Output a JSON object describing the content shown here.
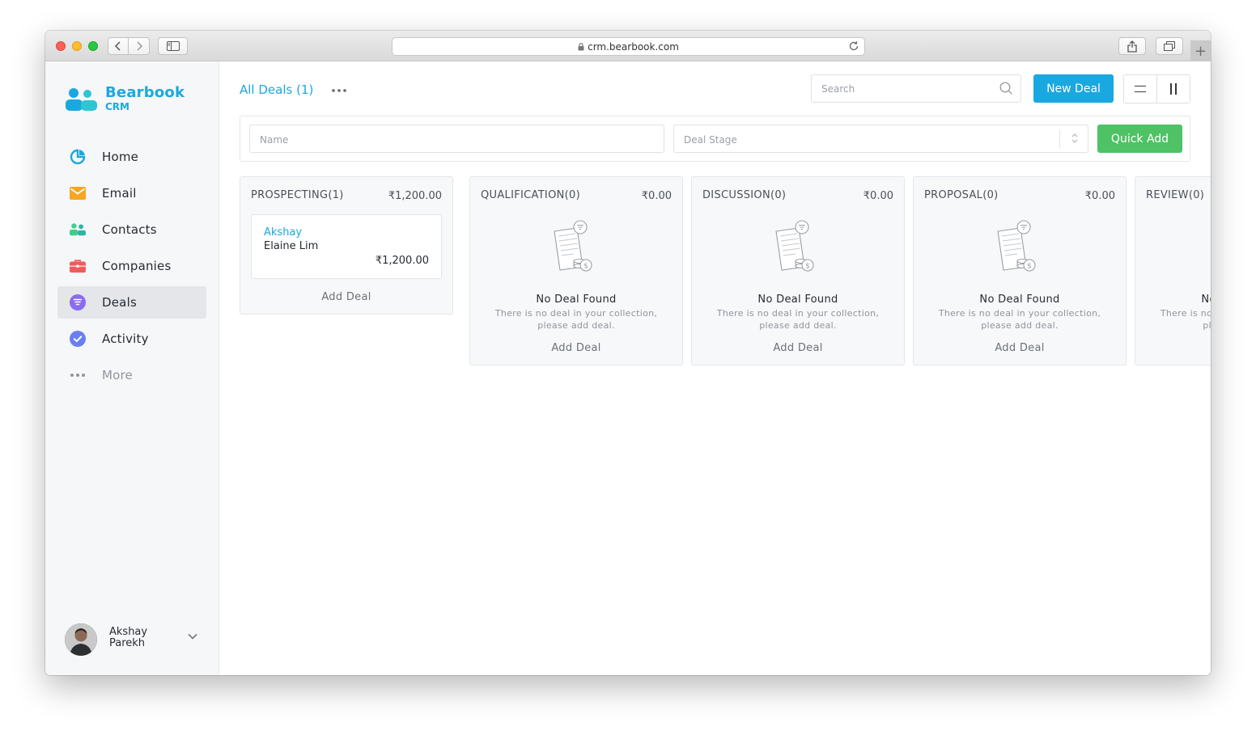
{
  "browser": {
    "url": "crm.bearbook.com"
  },
  "brand": {
    "name": "Bearbook",
    "sub": "CRM",
    "color": "#1aa8e0"
  },
  "nav": {
    "items": [
      {
        "label": "Home",
        "icon": "pie-chart-icon"
      },
      {
        "label": "Email",
        "icon": "envelope-icon"
      },
      {
        "label": "Contacts",
        "icon": "people-icon"
      },
      {
        "label": "Companies",
        "icon": "briefcase-icon"
      },
      {
        "label": "Deals",
        "icon": "funnel-icon",
        "active": true
      },
      {
        "label": "Activity",
        "icon": "check-circle-icon"
      },
      {
        "label": "More",
        "icon": "dots-icon"
      }
    ]
  },
  "user": {
    "name": "Akshay Parekh"
  },
  "header": {
    "view_title": "All Deals (1)",
    "search_placeholder": "Search",
    "new_deal_label": "New Deal"
  },
  "quick_add": {
    "name_placeholder": "Name",
    "stage_placeholder": "Deal Stage",
    "button_label": "Quick Add"
  },
  "board": {
    "add_deal_label": "Add Deal",
    "empty_title": "No Deal Found",
    "empty_desc": "There is no deal in your collection, please add deal.",
    "columns": [
      {
        "stage": "PROSPECTING(1)",
        "total": "₹1,200.00",
        "deals": [
          {
            "owner": "Akshay",
            "name": "Elaine Lim",
            "amount": "₹1,200.00"
          }
        ]
      },
      {
        "stage": "QUALIFICATION(0)",
        "total": "₹0.00",
        "deals": []
      },
      {
        "stage": "DISCUSSION(0)",
        "total": "₹0.00",
        "deals": []
      },
      {
        "stage": "PROPOSAL(0)",
        "total": "₹0.00",
        "deals": []
      },
      {
        "stage": "REVIEW(0)",
        "total": "",
        "deals": []
      }
    ]
  },
  "colors": {
    "accent": "#1aa8e0",
    "success": "#4ec264",
    "email": "#f5a623",
    "contacts": "#3ecf8e",
    "companies": "#f15b5b",
    "deals": "#8a6cf0",
    "activity": "#6b7ff0"
  }
}
